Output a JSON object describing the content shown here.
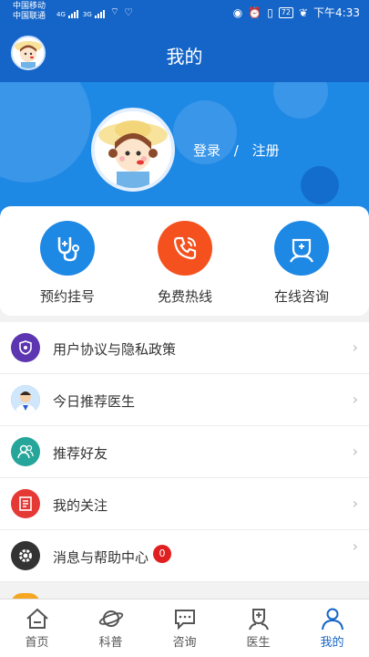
{
  "status_bar": {
    "carrier1": "中国移动",
    "carrier2": "中国联通",
    "net1": "4G",
    "net2": "3G",
    "battery": "72",
    "time": "下午4:33"
  },
  "header": {
    "title": "我的"
  },
  "profile": {
    "login": "登录",
    "separator": "/",
    "register": "注册"
  },
  "quick_actions": [
    {
      "label": "预约挂号",
      "icon": "stethoscope-icon",
      "color": "#1e88e5"
    },
    {
      "label": "免费热线",
      "icon": "phone-icon",
      "color": "#f4511e"
    },
    {
      "label": "在线咨询",
      "icon": "doctor-icon",
      "color": "#1e88e5"
    }
  ],
  "menu": [
    {
      "label": "用户协议与隐私政策",
      "icon": "shield-icon",
      "color": "#5e35b1"
    },
    {
      "label": "今日推荐医生",
      "icon": "doctor-avatar-icon",
      "color": "#42a5f5"
    },
    {
      "label": "推荐好友",
      "icon": "friends-icon",
      "color": "#26a69a"
    },
    {
      "label": "我的关注",
      "icon": "document-icon",
      "color": "#e53935"
    },
    {
      "label": "消息与帮助中心",
      "icon": "gear-icon",
      "color": "#333333",
      "badge": "0"
    }
  ],
  "tabs": [
    {
      "label": "首页",
      "icon": "home-icon",
      "active": false
    },
    {
      "label": "科普",
      "icon": "planet-icon",
      "active": false
    },
    {
      "label": "咨询",
      "icon": "chat-icon",
      "active": false
    },
    {
      "label": "医生",
      "icon": "doctor-icon",
      "active": false
    },
    {
      "label": "我的",
      "icon": "user-icon",
      "active": true
    }
  ],
  "colors": {
    "primary": "#1565c8",
    "banner": "#1e88e5",
    "badge": "#e02020"
  }
}
